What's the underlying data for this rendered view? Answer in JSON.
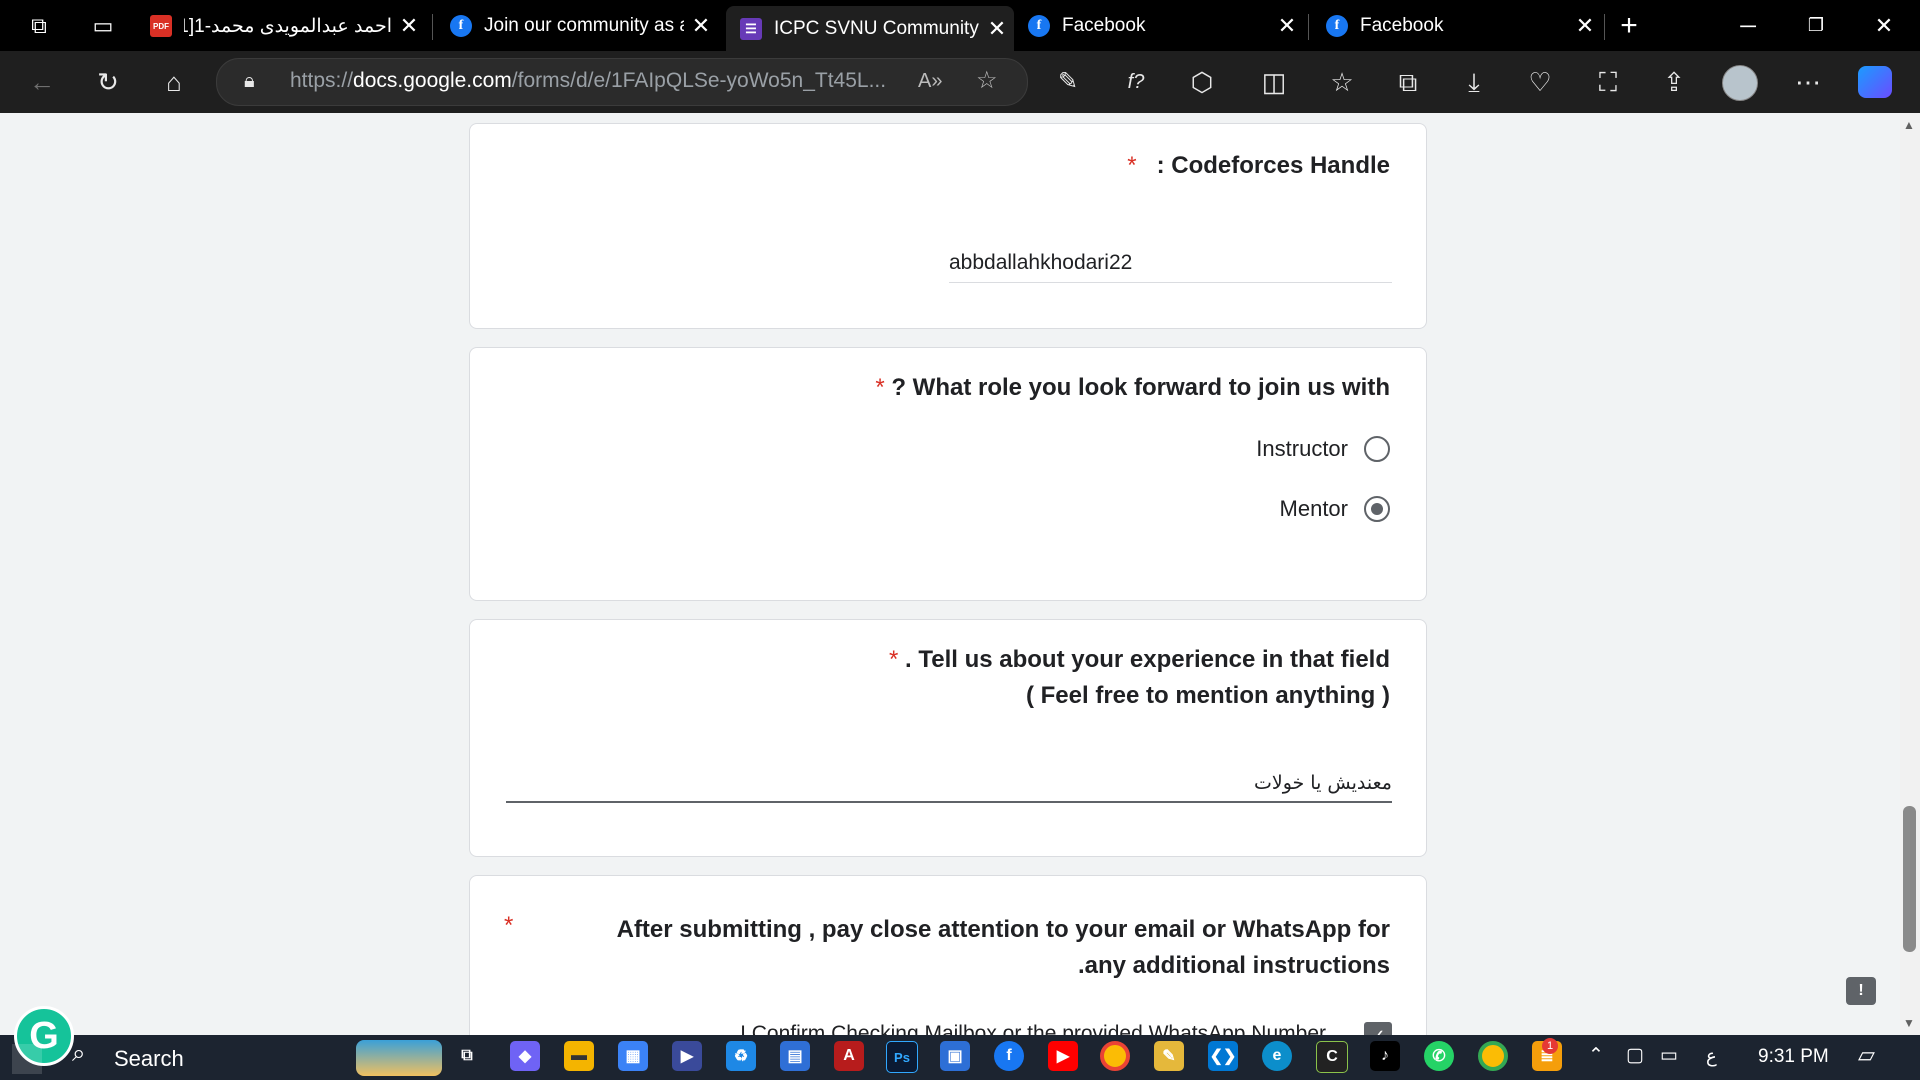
{
  "browser": {
    "tabs": [
      {
        "title": "احمد عبدالمويدى محمد-1[1",
        "icon": "pdf-icon",
        "active": false
      },
      {
        "title": "Join our community as a",
        "icon": "facebook-icon",
        "active": false
      },
      {
        "title": "ICPC SVNU Community -",
        "icon": "google-forms-icon",
        "active": true
      },
      {
        "title": "Facebook",
        "icon": "facebook-icon",
        "active": false
      },
      {
        "title": "Facebook",
        "icon": "facebook-icon",
        "active": false
      }
    ],
    "new_tab_label": "+",
    "url_prefix": "https://",
    "url_domain": "docs.google.com",
    "url_path": "/forms/d/e/1FAIpQLSe-yoWo5n_Tt45L..."
  },
  "form": {
    "q1": {
      "title": ": Codeforces Handle",
      "required_mark": "*",
      "answer": "abbdallahkhodari22"
    },
    "q2": {
      "title": "? What role you look forward to join us with",
      "required_mark": "*",
      "options": [
        {
          "label": "Instructor",
          "selected": false
        },
        {
          "label": "Mentor",
          "selected": true
        }
      ]
    },
    "q3": {
      "title_line1": ". Tell us about your experience in that field",
      "title_line2": "( Feel free to mention anything )",
      "required_mark": "*",
      "answer": "معنديش يا خولات"
    },
    "q4": {
      "title_line1": "After submitting , pay close attention to your email or WhatsApp for",
      "title_line2": ".any additional instructions",
      "required_mark": "*",
      "checkbox_label_partial": "I Confirm Checking Mailbox or the provided WhatsApp Number"
    }
  },
  "taskbar": {
    "search_label": "Search",
    "time": "9:31 PM",
    "language": "ع",
    "notification_badge": "1"
  }
}
